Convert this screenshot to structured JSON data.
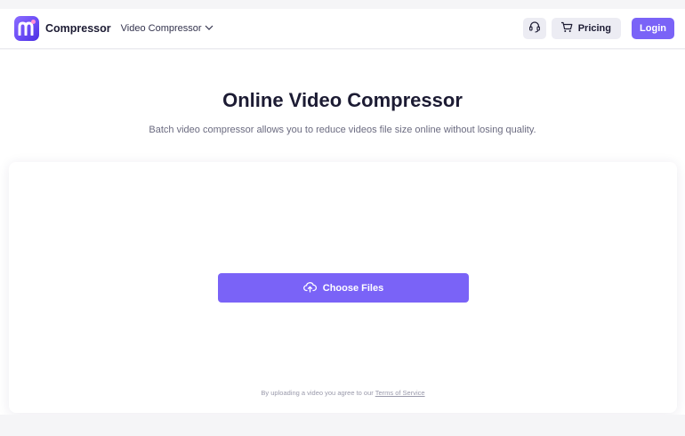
{
  "header": {
    "brand": "Compressor",
    "nav_dropdown_label": "Video Compressor",
    "pricing_label": "Pricing",
    "login_label": "Login"
  },
  "hero": {
    "title": "Online Video Compressor",
    "subtitle": "Batch video compressor allows you to reduce videos file size online without losing quality."
  },
  "upload": {
    "choose_files_label": "Choose Files",
    "terms_prefix": "By uploading a video you agree to our",
    "terms_link": "Terms of Service"
  },
  "icons": {
    "logo": "m-logo-icon",
    "dropdown": "chevron-down-icon",
    "support": "headset-icon",
    "pricing": "cart-icon",
    "upload": "upload-cloud-icon"
  },
  "colors": {
    "accent": "#7a63f7",
    "text": "#1c1b33",
    "muted": "#6b6b80",
    "chip_bg": "#ececf3"
  }
}
